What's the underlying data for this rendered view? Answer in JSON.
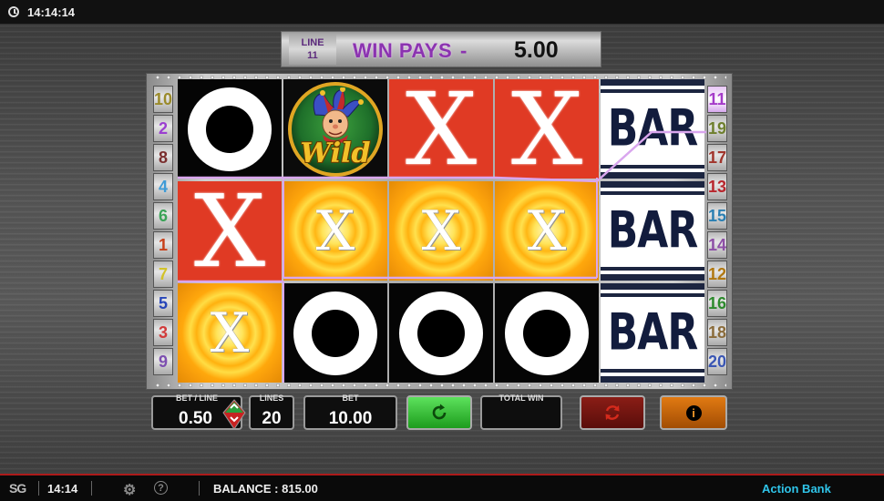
{
  "top_bar": {
    "time": "14:14:14"
  },
  "win_banner": {
    "line_label": "LINE",
    "line_number": "11",
    "win_pays_label": "WIN PAYS",
    "dash": "-",
    "amount": "5.00"
  },
  "left_lines": [
    "10",
    "2",
    "8",
    "4",
    "6",
    "1",
    "7",
    "5",
    "3",
    "9"
  ],
  "right_lines": [
    "11",
    "19",
    "17",
    "13",
    "15",
    "14",
    "12",
    "16",
    "18",
    "20"
  ],
  "line_colors": {
    "1": "#c8401a",
    "2": "#9b3fd0",
    "3": "#d13b3b",
    "4": "#3f9bd6",
    "5": "#2846b8",
    "6": "#3aa357",
    "7": "#d2c22a",
    "8": "#7a2e2e",
    "9": "#7d4fb0",
    "10": "#9a8a2a",
    "11": "#a53bc9",
    "12": "#b0770f",
    "13": "#b8262d",
    "14": "#8d4fa6",
    "15": "#2a7fb2",
    "16": "#2d8a2d",
    "17": "#a1352c",
    "18": "#8a6b3a",
    "19": "#6e7f2d",
    "20": "#3a56b4"
  },
  "reels": [
    [
      {
        "sym": "o",
        "bg": "black"
      },
      {
        "sym": "x",
        "bg": "red"
      },
      {
        "sym": "x-small",
        "bg": "gold"
      }
    ],
    [
      {
        "sym": "wild",
        "bg": "wild",
        "text": "Wild"
      },
      {
        "sym": "x-small",
        "bg": "gold"
      },
      {
        "sym": "o",
        "bg": "black"
      }
    ],
    [
      {
        "sym": "x",
        "bg": "red"
      },
      {
        "sym": "x-small",
        "bg": "gold"
      },
      {
        "sym": "o",
        "bg": "black"
      }
    ],
    [
      {
        "sym": "x",
        "bg": "red"
      },
      {
        "sym": "x-small",
        "bg": "gold"
      },
      {
        "sym": "o",
        "bg": "black"
      }
    ],
    [
      {
        "sym": "bar",
        "bg": "white-bar",
        "text": "BAR"
      },
      {
        "sym": "bar",
        "bg": "white-bar",
        "text": "BAR"
      },
      {
        "sym": "bar",
        "bg": "white-bar",
        "text": "BAR"
      }
    ]
  ],
  "controls": {
    "bet_line_label": "BET / LINE",
    "bet_line_value": "0.50",
    "lines_label": "LINES",
    "lines_value": "20",
    "bet_label": "BET",
    "bet_value": "10.00",
    "total_win_label": "TOTAL WIN",
    "total_win_value": ""
  },
  "bottom_bar": {
    "logo": "SG",
    "time": "14:14",
    "balance": "BALANCE : 815.00",
    "game_name": "Action Bank"
  },
  "icons": {
    "spin": "refresh-icon",
    "autoplay": "autoplay-icon",
    "info": "info-icon",
    "settings": "gear-icon",
    "help": "help-icon",
    "clock": "clock-icon"
  }
}
